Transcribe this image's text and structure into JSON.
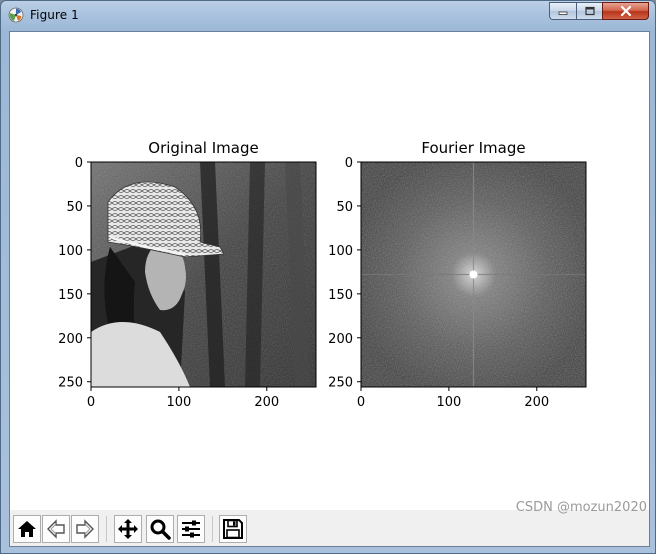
{
  "window": {
    "title": "Figure 1",
    "controls": [
      "minimize-icon",
      "maximize-icon",
      "close-icon"
    ]
  },
  "figure": {
    "subplots": [
      {
        "title": "Original Image",
        "image": "grayscale photo of a woman in a lace cap, profile view, trees behind",
        "x_ticks": [
          "0",
          "100",
          "200"
        ],
        "y_ticks": [
          "0",
          "50",
          "100",
          "150",
          "200",
          "250"
        ],
        "xlim": [
          0,
          256
        ],
        "ylim": [
          256,
          0
        ]
      },
      {
        "title": "Fourier Image",
        "image": "grayscale magnitude spectrum with a bright center and cross-shaped lines",
        "x_ticks": [
          "0",
          "100",
          "200"
        ],
        "y_ticks": [
          "0",
          "50",
          "100",
          "150",
          "200",
          "250"
        ],
        "xlim": [
          0,
          256
        ],
        "ylim": [
          256,
          0
        ]
      }
    ]
  },
  "toolbar": {
    "buttons": [
      {
        "name": "home",
        "icon": "home-icon"
      },
      {
        "name": "back",
        "icon": "left-arrow-icon"
      },
      {
        "name": "forward",
        "icon": "right-arrow-icon"
      },
      {
        "name": "pan",
        "icon": "move-icon"
      },
      {
        "name": "zoom",
        "icon": "magnifier-icon"
      },
      {
        "name": "configure-subplots",
        "icon": "sliders-icon"
      },
      {
        "name": "save",
        "icon": "floppy-icon"
      }
    ]
  },
  "watermark": "CSDN @mozun2020"
}
